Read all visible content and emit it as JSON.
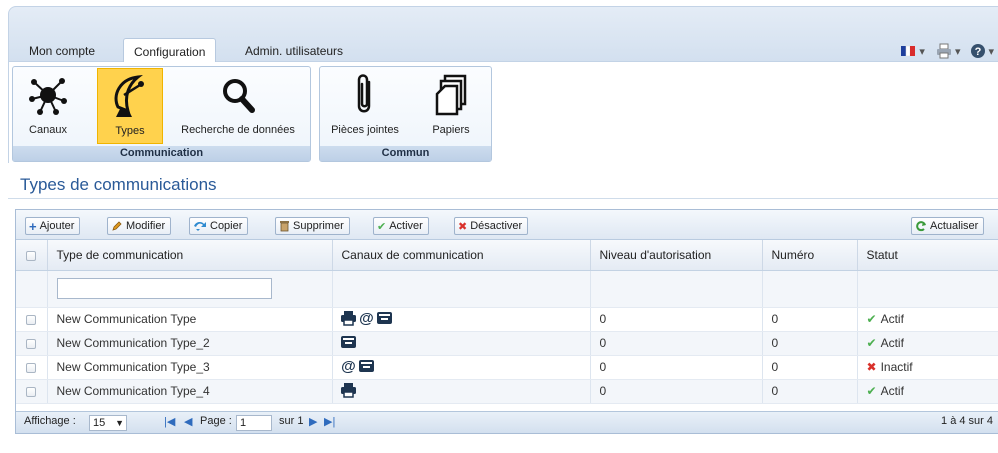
{
  "tabs": [
    {
      "label": "Mon compte"
    },
    {
      "label": "Configuration"
    },
    {
      "label": "Admin. utilisateurs"
    }
  ],
  "ribbon": {
    "groups": [
      {
        "label": "Communication",
        "buttons": [
          {
            "label": "Canaux",
            "icon": "hub-icon"
          },
          {
            "label": "Types",
            "icon": "satellite-dish-icon"
          },
          {
            "label": "Recherche de données",
            "icon": "magnifier-icon"
          }
        ]
      },
      {
        "label": "Commun",
        "buttons": [
          {
            "label": "Pièces jointes",
            "icon": "paperclip-icon"
          },
          {
            "label": "Papiers",
            "icon": "papers-icon"
          }
        ]
      }
    ]
  },
  "page": {
    "title": "Types de communications"
  },
  "toolbar": {
    "add_label": "Ajouter",
    "edit_label": "Modifier",
    "copy_label": "Copier",
    "delete_label": "Supprimer",
    "activate_label": "Activer",
    "deactivate_label": "Désactiver",
    "refresh_label": "Actualiser"
  },
  "grid": {
    "columns": [
      "Type de communication",
      "Canaux de communication",
      "Niveau d'autorisation",
      "Numéro",
      "Statut"
    ],
    "rows": [
      {
        "type": "New Communication Type",
        "channels": [
          "printer",
          "email",
          "fax"
        ],
        "level": "0",
        "number": "0",
        "status": "Actif"
      },
      {
        "type": "New Communication Type_2",
        "channels": [
          "fax"
        ],
        "level": "0",
        "number": "0",
        "status": "Actif"
      },
      {
        "type": "New Communication Type_3",
        "channels": [
          "email",
          "fax"
        ],
        "level": "0",
        "number": "0",
        "status": "Inactif"
      },
      {
        "type": "New Communication Type_4",
        "channels": [
          "printer"
        ],
        "level": "0",
        "number": "0",
        "status": "Actif"
      }
    ]
  },
  "pager": {
    "display_label": "Affichage :",
    "page_size": "15",
    "page_label": "Page :",
    "page_value": "1",
    "of_label": "sur 1",
    "summary": "1 à 4 sur 4"
  },
  "colors": {
    "accent": "#2a5a98",
    "selected": "#ffd24d",
    "active": "#4caf50",
    "inactive": "#d9312b"
  }
}
